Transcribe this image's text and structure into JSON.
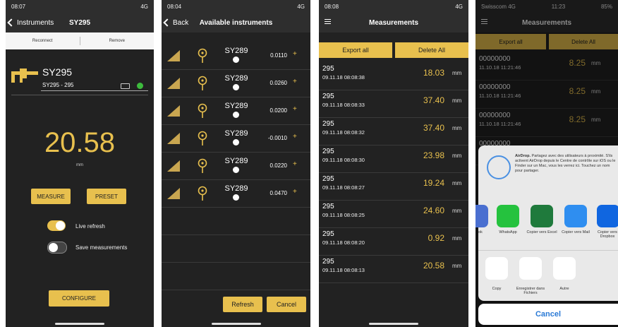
{
  "screen1": {
    "time": "08:07",
    "signal": "4G",
    "back": "Instruments",
    "title": "SY295",
    "reconnect": "Reconnect",
    "remove": "Remove",
    "device_name": "SY295",
    "device_sub": "SY295 - 295",
    "value": "20.58",
    "unit": "mm",
    "measure": "MEASURE",
    "preset": "PRESET",
    "live_refresh": "Live refresh",
    "save_measurements": "Save measurements",
    "configure": "CONFIGURE",
    "accent": "#e8c04e",
    "status_dot_color": "#3dbb3d"
  },
  "screen2": {
    "time": "08:04",
    "signal": "4G",
    "back": "Back",
    "title": "Available instruments",
    "instruments": [
      {
        "name": "SY289",
        "value": "0.0110"
      },
      {
        "name": "SY289",
        "value": "0.0260"
      },
      {
        "name": "SY289",
        "value": "0.0200"
      },
      {
        "name": "SY289",
        "value": "-0.0010"
      },
      {
        "name": "SY289",
        "value": "0.0220"
      },
      {
        "name": "SY289",
        "value": "0.0470"
      }
    ],
    "plus": "+",
    "refresh": "Refresh",
    "cancel": "Cancel"
  },
  "screen3": {
    "time": "08:08",
    "signal": "4G",
    "title": "Measurements",
    "export": "Export all",
    "delete": "Delete All",
    "unit": "mm",
    "rows": [
      {
        "id": "295",
        "date": "09.11.18 08:08:38",
        "value": "18.03"
      },
      {
        "id": "295",
        "date": "09.11.18 08:08:33",
        "value": "37.40"
      },
      {
        "id": "295",
        "date": "09.11.18 08:08:32",
        "value": "37.40"
      },
      {
        "id": "295",
        "date": "09.11.18 08:08:30",
        "value": "23.98"
      },
      {
        "id": "295",
        "date": "09.11.18 08:08:27",
        "value": "19.24"
      },
      {
        "id": "295",
        "date": "09.11.18 08:08:25",
        "value": "24.60"
      },
      {
        "id": "295",
        "date": "09.11.18 08:08:20",
        "value": "0.92"
      },
      {
        "id": "295",
        "date": "09.11.18 08:08:13",
        "value": "20.58"
      }
    ]
  },
  "screen4": {
    "carrier": "Swisscom 4G",
    "time": "11:23",
    "battery": "85%",
    "title": "Measurements",
    "export": "Export all",
    "delete": "Delete All",
    "unit": "mm",
    "rows": [
      {
        "id": "00000000",
        "date": "11.10.18 11:21:46",
        "value": "8.25"
      },
      {
        "id": "00000000",
        "date": "11.10.18 11:21:46",
        "value": "8.25"
      },
      {
        "id": "00000000",
        "date": "11.10.18 11:21:46",
        "value": "8.25"
      },
      {
        "id": "00000000"
      }
    ],
    "airdrop_title": "AirDrop.",
    "airdrop_text": "Partagez avec des utilisateurs à proximité. S'ils activent AirDrop depuis le Centre de contrôle sur iOS ou le Finder sur un Mac, vous les verrez ici. Touchez un nom pour partager.",
    "apps": [
      {
        "label": "ok",
        "color": "#4a6fd0"
      },
      {
        "label": "WhatsApp",
        "color": "#25c23e"
      },
      {
        "label": "Copier vers Excel",
        "color": "#1f7a3c"
      },
      {
        "label": "Copier vers Mail",
        "color": "#2f8ef0"
      },
      {
        "label": "Copier vers Dropbox",
        "color": "#1066e0"
      }
    ],
    "actions": [
      {
        "label": "Copy"
      },
      {
        "label": "Enregistrer dans Fichiers"
      },
      {
        "label": "Autre"
      }
    ],
    "cancel": "Cancel"
  }
}
